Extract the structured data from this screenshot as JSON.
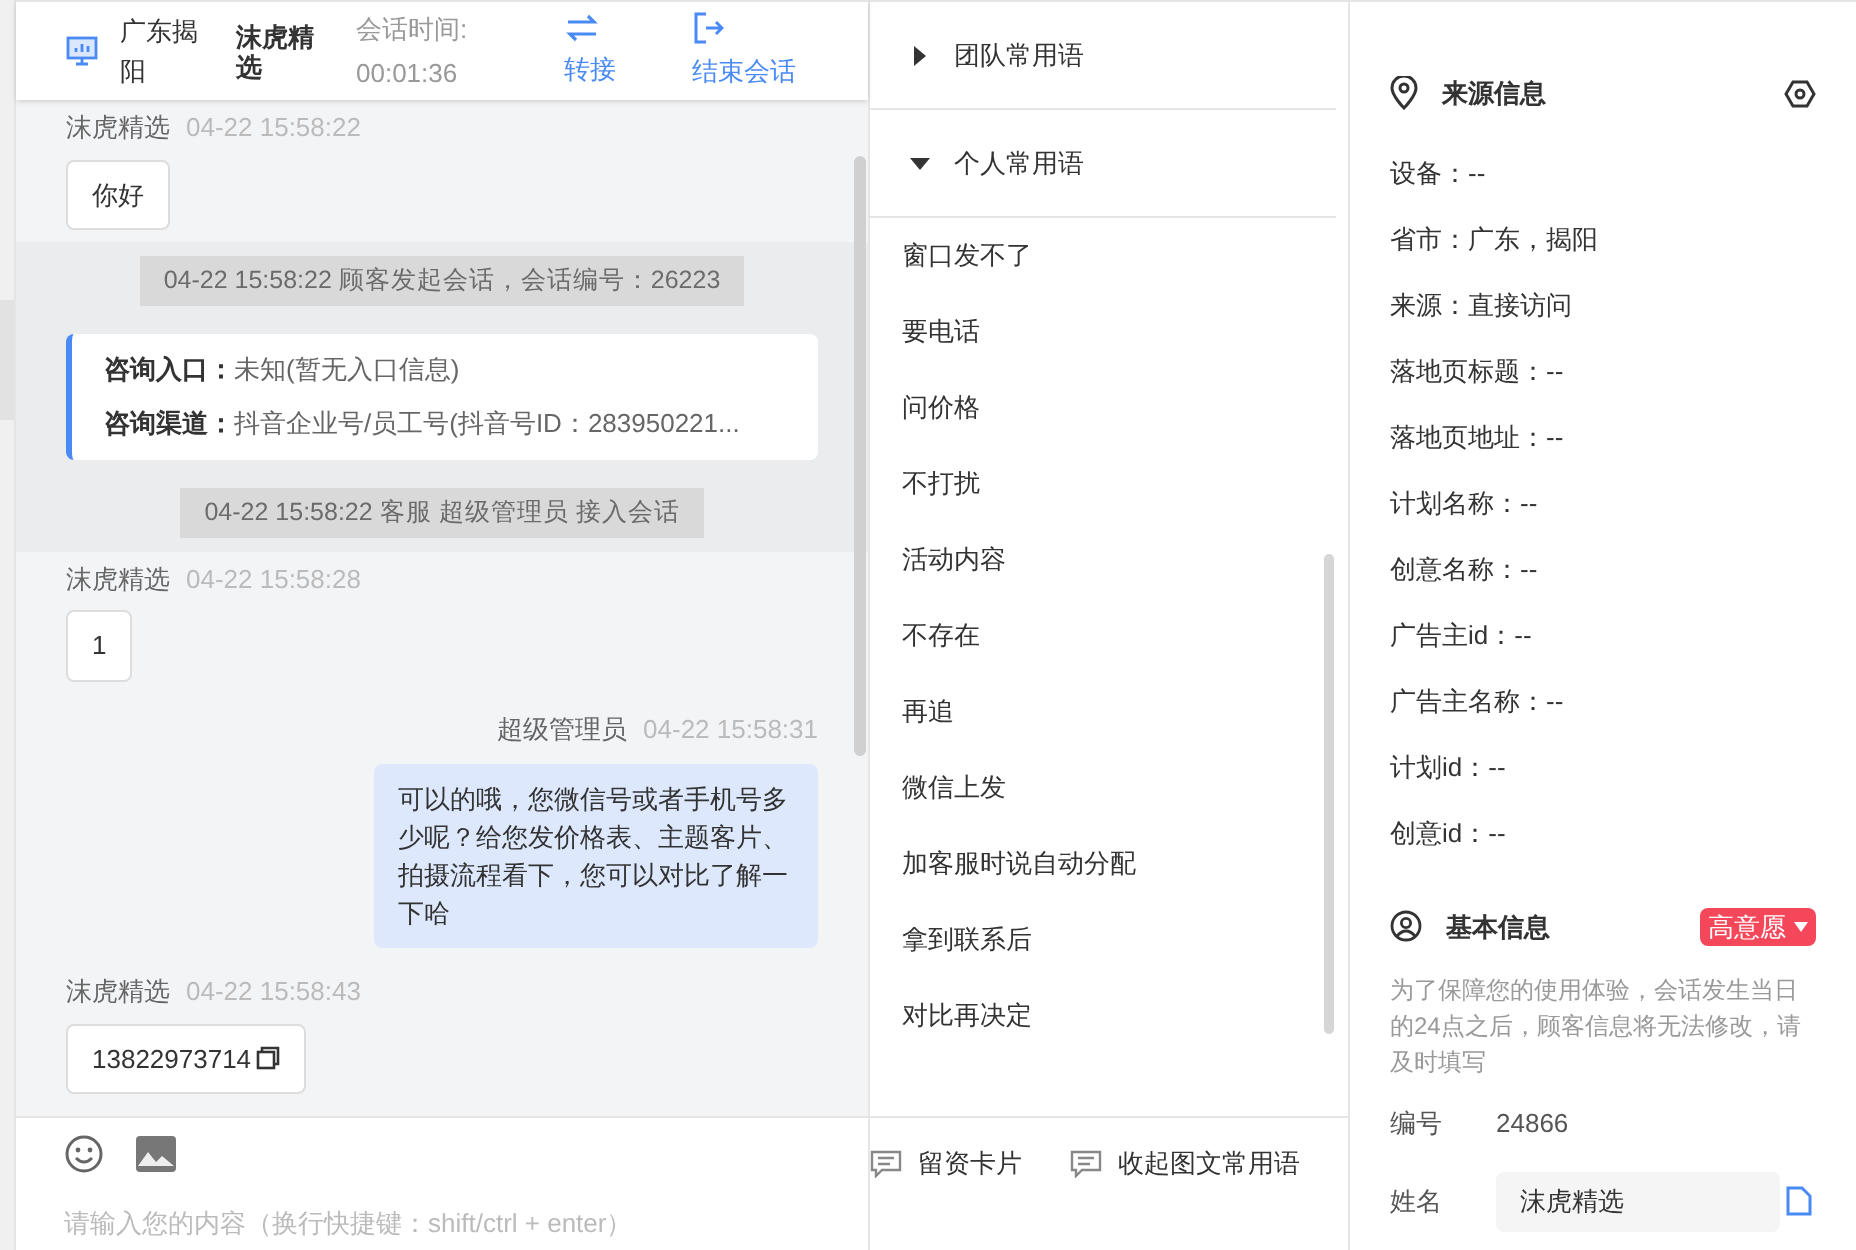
{
  "header": {
    "location": "广东揭阳",
    "customer": "沫虎精选",
    "timer_label": "会话时间:",
    "timer": "00:01:36",
    "actions": [
      {
        "label": "转接",
        "kind": "transfer"
      },
      {
        "label": "结束会话",
        "kind": "end"
      }
    ]
  },
  "messages": [
    {
      "kind": "incoming",
      "sender": "沫虎精选",
      "time": "04-22 15:58:22",
      "text": "你好"
    },
    {
      "kind": "system",
      "text": "04-22 15:58:22 顾客发起会话，会话编号：26223"
    },
    {
      "kind": "info",
      "rows": [
        {
          "label": "咨询入口：",
          "value": "未知(暂无入口信息)"
        },
        {
          "label": "咨询渠道：",
          "value": "抖音企业号/员工号(抖音号ID：283950221..."
        }
      ]
    },
    {
      "kind": "system",
      "text": "04-22 15:58:22 客服 超级管理员 接入会话"
    },
    {
      "kind": "incoming",
      "sender": "沫虎精选",
      "time": "04-22 15:58:28",
      "text": "1"
    },
    {
      "kind": "outgoing",
      "sender": "超级管理员",
      "time": "04-22 15:58:31",
      "text": "可以的哦，您微信号或者手机号多少呢？给您发价格表、主题客片、拍摄流程看下，您可以对比了解一下哈"
    },
    {
      "kind": "incoming",
      "sender": "沫虎精选",
      "time": "04-22 15:58:43",
      "text": "13822973714",
      "copyable": true
    }
  ],
  "composer": {
    "placeholder": "请输入您的内容（换行快捷键：shift/ctrl + enter）",
    "tools": [
      {
        "label": "留资卡片"
      },
      {
        "label": "收起图文常用语"
      }
    ]
  },
  "phrases": {
    "groups": [
      {
        "title": "团队常用语",
        "expanded": false
      },
      {
        "title": "个人常用语",
        "expanded": true,
        "items": [
          "窗口发不了",
          "要电话",
          "问价格",
          "不打扰",
          "活动内容",
          "不存在",
          "再追",
          "微信上发",
          "加客服时说自动分配",
          "拿到联系后",
          "对比再决定"
        ]
      }
    ]
  },
  "source_info": {
    "title": "来源信息",
    "fields": [
      "设备：--",
      "省市：广东，揭阳",
      "来源：直接访问",
      "落地页标题：--",
      "落地页地址：--",
      "计划名称：--",
      "创意名称：--",
      "广告主id：--",
      "广告主名称：--",
      "计划id：--",
      "创意id：--"
    ]
  },
  "basic_info": {
    "title": "基本信息",
    "intent": {
      "label": "高意愿",
      "color": "#f5475a"
    },
    "notice": "为了保障您的使用体验，会话发生当日的24点之后，顾客信息将无法修改，请及时填写",
    "fields": [
      {
        "kind": "text",
        "label": "编号",
        "value": "24866"
      },
      {
        "kind": "input",
        "label": "姓名",
        "value": "沫虎精选"
      }
    ]
  }
}
